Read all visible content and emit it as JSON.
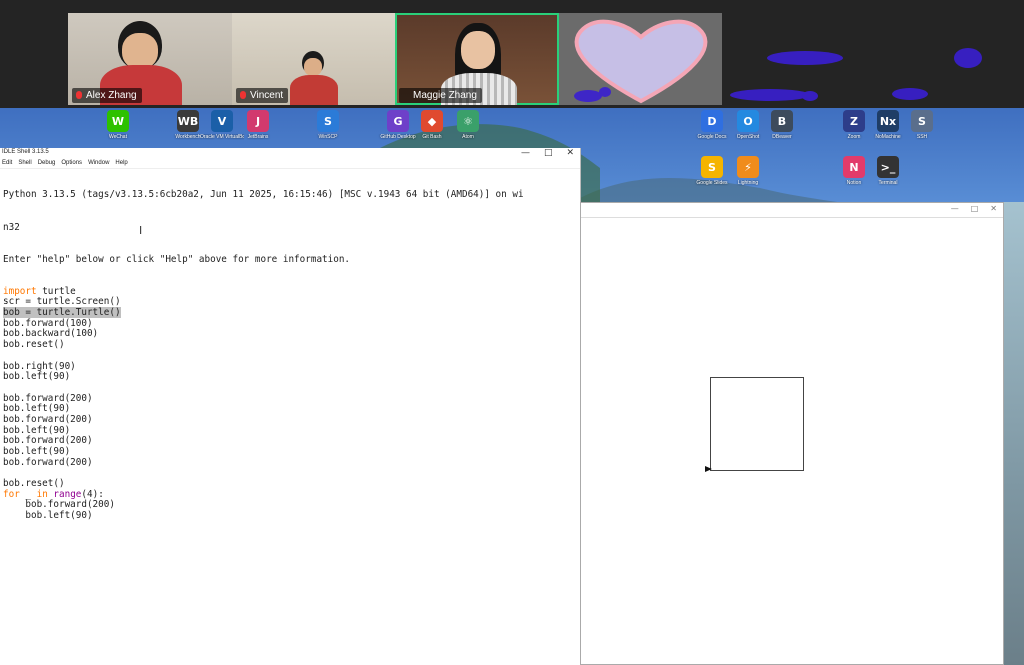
{
  "participants": [
    {
      "name": "Alex Zhang",
      "active": false
    },
    {
      "name": "Vincent",
      "active": false
    },
    {
      "name": "Maggie Zhang",
      "active": true
    }
  ],
  "desktop_icons": [
    {
      "label": "WeChat",
      "color": "#2dc100",
      "glyph": "W"
    },
    {
      "label": "Workbench",
      "color": "#3a3a3a",
      "glyph": "WB"
    },
    {
      "label": "Oracle VM VirtualBox",
      "color": "#1b5fa8",
      "glyph": "V"
    },
    {
      "label": "JetBrains",
      "color": "#d23a6e",
      "glyph": "J"
    },
    {
      "label": "WinSCP",
      "color": "#2b7bd8",
      "glyph": "S"
    },
    {
      "label": "GitHub Desktop",
      "color": "#6e40c9",
      "glyph": "G"
    },
    {
      "label": "Git Bash",
      "color": "#e04a2f",
      "glyph": "◆"
    },
    {
      "label": "Atom",
      "color": "#3aa06a",
      "glyph": "⚛"
    },
    {
      "label": "Google Docs",
      "color": "#2f6fe0",
      "glyph": "D"
    },
    {
      "label": "OpenShot",
      "color": "#2489e0",
      "glyph": "O"
    },
    {
      "label": "DBeaver",
      "color": "#3d4b5c",
      "glyph": "B"
    },
    {
      "label": "Zoom",
      "color": "#2d3d8a",
      "glyph": "Z"
    },
    {
      "label": "NoMachine",
      "color": "#1f3d66",
      "glyph": "Nx"
    },
    {
      "label": "SSH",
      "color": "#5a6e8c",
      "glyph": "S"
    },
    {
      "label": "Google Slides",
      "color": "#f5b400",
      "glyph": "S"
    },
    {
      "label": "Lightning",
      "color": "#f08c1c",
      "glyph": "⚡"
    },
    {
      "label": "Notion",
      "color": "#e23b6b",
      "glyph": "N"
    },
    {
      "label": "Terminal",
      "color": "#333333",
      "glyph": ">_"
    }
  ],
  "shell": {
    "title": "IDLE Shell 3.13.5",
    "menu": [
      "Edit",
      "Shell",
      "Debug",
      "Options",
      "Window",
      "Help"
    ],
    "banner1": "Python 3.13.5 (tags/v3.13.5:6cb20a2, Jun 11 2025, 16:15:46) [MSC v.1943 64 bit (AMD64)] on wi",
    "banner2": "n32",
    "banner3": "Enter \"help\" below or click \"Help\" above for more information.",
    "lines": [
      {
        "text": "import turtle"
      },
      {
        "text": "scr = turtle.Screen()"
      },
      {
        "text": "bob = turtle.Turtle()"
      },
      {
        "text": "bob.forward(100)"
      },
      {
        "text": "bob.backward(100)"
      },
      {
        "text": "bob.reset()"
      },
      {
        "text": ""
      },
      {
        "text": "bob.right(90)"
      },
      {
        "text": "bob.left(90)"
      },
      {
        "text": ""
      },
      {
        "text": "bob.forward(200)"
      },
      {
        "text": "bob.left(90)"
      },
      {
        "text": "bob.forward(200)"
      },
      {
        "text": "bob.left(90)"
      },
      {
        "text": "bob.forward(200)"
      },
      {
        "text": "bob.left(90)"
      },
      {
        "text": "bob.forward(200)"
      },
      {
        "text": ""
      },
      {
        "text": "bob.reset()"
      },
      {
        "text": "for _ in range(4):"
      },
      {
        "text": "    bob.forward(200)"
      },
      {
        "text": "    bob.left(90)"
      }
    ]
  },
  "window_buttons": {
    "min": "—",
    "max": "□",
    "close": "✕"
  }
}
